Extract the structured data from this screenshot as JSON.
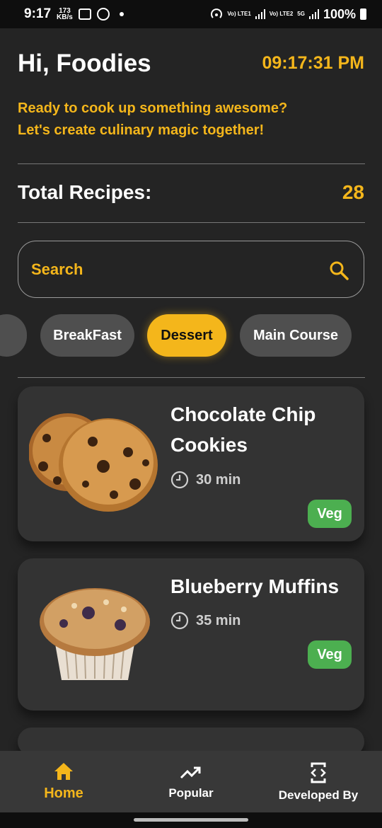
{
  "status_bar": {
    "time": "9:17",
    "speed_value": "173",
    "speed_unit": "KB/s",
    "net1": "Vo) LTE1",
    "net2": "Vo) LTE2",
    "network_5g": "5G",
    "battery": "100%"
  },
  "header": {
    "greeting": "Hi, Foodies",
    "clock": "09:17:31 PM",
    "tagline_1": "Ready to cook up something awesome?",
    "tagline_2": "Let's create culinary magic together!"
  },
  "stats": {
    "label": "Total Recipes:",
    "count": "28"
  },
  "search": {
    "placeholder": "Search"
  },
  "categories": [
    {
      "label": "BreakFast",
      "active": false
    },
    {
      "label": "Dessert",
      "active": true
    },
    {
      "label": "Main Course",
      "active": false
    }
  ],
  "recipes": [
    {
      "title": "Chocolate Chip Cookies",
      "time": "30 min",
      "diet": "Veg"
    },
    {
      "title": "Blueberry Muffins",
      "time": "35 min",
      "diet": "Veg"
    }
  ],
  "bottom_nav": {
    "home": "Home",
    "popular": "Popular",
    "developed_by": "Developed By"
  },
  "colors": {
    "accent": "#f4b61b",
    "background": "#242424",
    "card": "#333333",
    "veg": "#4caf50"
  }
}
